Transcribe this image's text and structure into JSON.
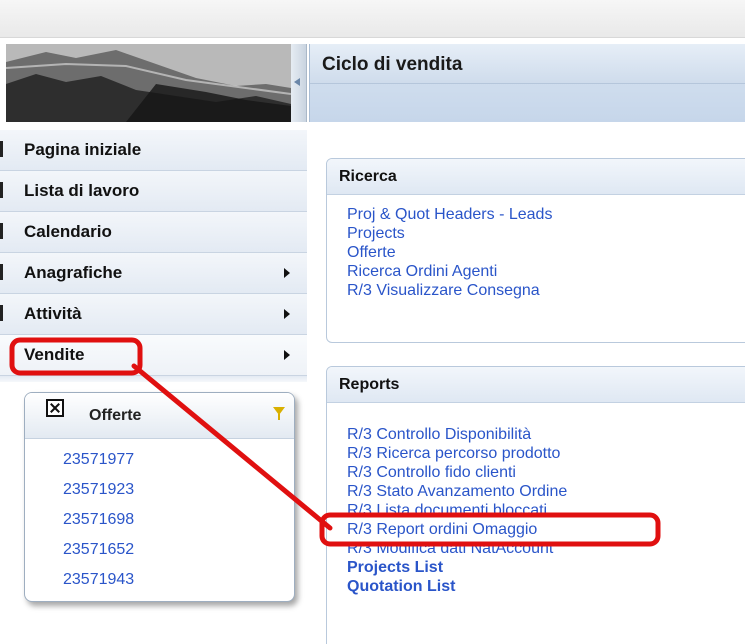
{
  "nav": {
    "items": [
      {
        "label": "Pagina iniziale",
        "has_submenu": false
      },
      {
        "label": "Lista di lavoro",
        "has_submenu": false
      },
      {
        "label": "Calendario",
        "has_submenu": false
      },
      {
        "label": "Anagrafiche",
        "has_submenu": true
      },
      {
        "label": "Attività",
        "has_submenu": true
      },
      {
        "label": "Vendite",
        "has_submenu": true
      }
    ]
  },
  "main": {
    "title": "Ciclo di vendita",
    "ricerca": {
      "title": "Ricerca",
      "links": [
        "Proj & Quot Headers - Leads",
        "Projects",
        "Offerte",
        "Ricerca Ordini Agenti",
        "R/3 Visualizzare Consegna"
      ]
    },
    "reports": {
      "title": "Reports",
      "links": [
        "R/3 Controllo Disponibilità",
        "R/3 Ricerca percorso prodotto",
        "R/3 Controllo fido clienti",
        "R/3 Stato Avanzamento Ordine",
        "R/3 Lista documenti bloccati",
        "R/3 Report ordini Omaggio",
        "R/3 Modifica dati NatAccount",
        "Projects List",
        "Quotation List"
      ]
    }
  },
  "flyout": {
    "title": "Offerte",
    "items": [
      "23571977",
      "23571923",
      "23571698",
      "23571652",
      "23571943"
    ]
  },
  "colors": {
    "link": "#2a55c9",
    "annotation": "#e01010"
  },
  "icons": {
    "close": "close-icon",
    "filter": "filter-icon",
    "submenu": "chevron-right-icon",
    "collapse": "collapse-left-icon"
  }
}
